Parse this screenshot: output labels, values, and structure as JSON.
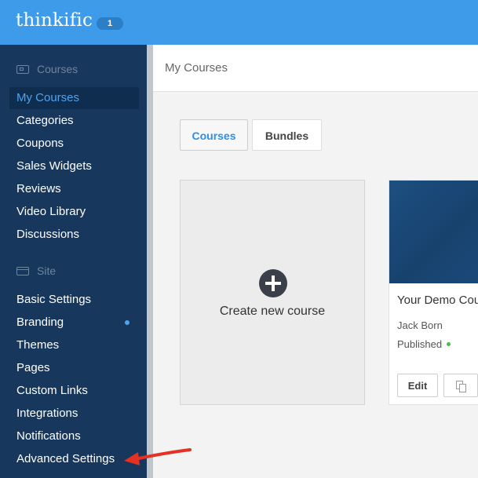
{
  "header": {
    "logo": "thinkific",
    "badge": "1"
  },
  "sidebar": {
    "sections": [
      {
        "title": "Courses",
        "items": [
          "My Courses",
          "Categories",
          "Coupons",
          "Sales Widgets",
          "Reviews",
          "Video Library",
          "Discussions"
        ]
      },
      {
        "title": "Site",
        "items": [
          "Basic Settings",
          "Branding",
          "Themes",
          "Pages",
          "Custom Links",
          "Integrations",
          "Notifications",
          "Advanced Settings"
        ]
      }
    ],
    "active_item": "My Courses"
  },
  "main": {
    "title": "My Courses",
    "tabs": [
      "Courses",
      "Bundles"
    ],
    "create_card": {
      "label": "Create new course"
    },
    "course_card": {
      "name": "Your Demo Cou",
      "author": "Jack Born",
      "status": "Published",
      "edit_label": "Edit"
    }
  },
  "colors": {
    "header": "#3d9be9",
    "sidebar": "#17375c",
    "accent": "#4ea3ef",
    "annotation_arrow": "#e53022"
  }
}
